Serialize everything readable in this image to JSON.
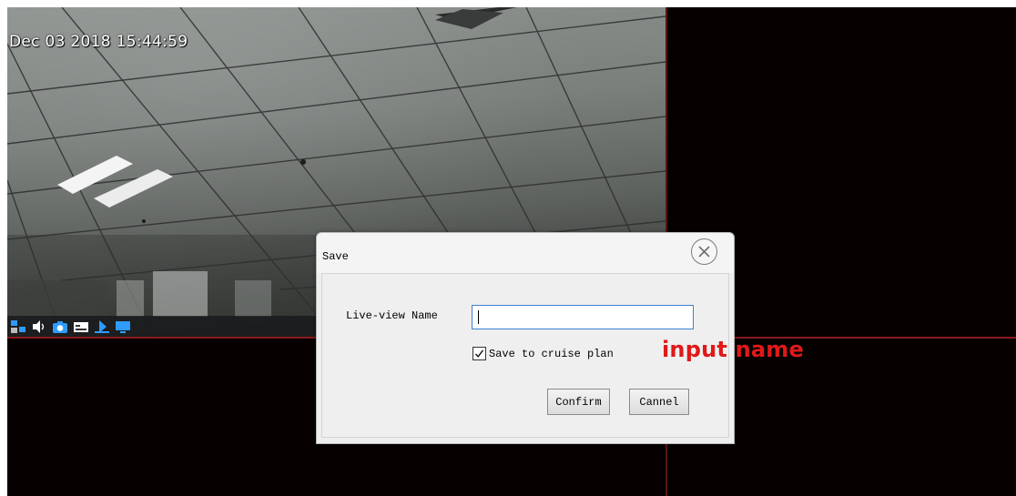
{
  "camera": {
    "osd_timestamp": "Dec 03 2018 15:44:59",
    "toolbar_icons": [
      "split-screen-icon",
      "audio-icon",
      "snapshot-icon",
      "record-icon",
      "ptz-icon",
      "fullscreen-icon"
    ]
  },
  "dialog": {
    "title": "Save",
    "live_view_label": "Live-view Name",
    "live_view_value": "",
    "cruise_checkbox_label": "Save to cruise plan",
    "cruise_checked": true,
    "confirm_label": "Confirm",
    "cancel_label": "Cannel"
  },
  "annotation": {
    "text": "input name",
    "color": "#e01919"
  },
  "colors": {
    "grid_line": "#8a1818",
    "input_focus": "#3c7fd4",
    "tile_background": "#060000"
  }
}
